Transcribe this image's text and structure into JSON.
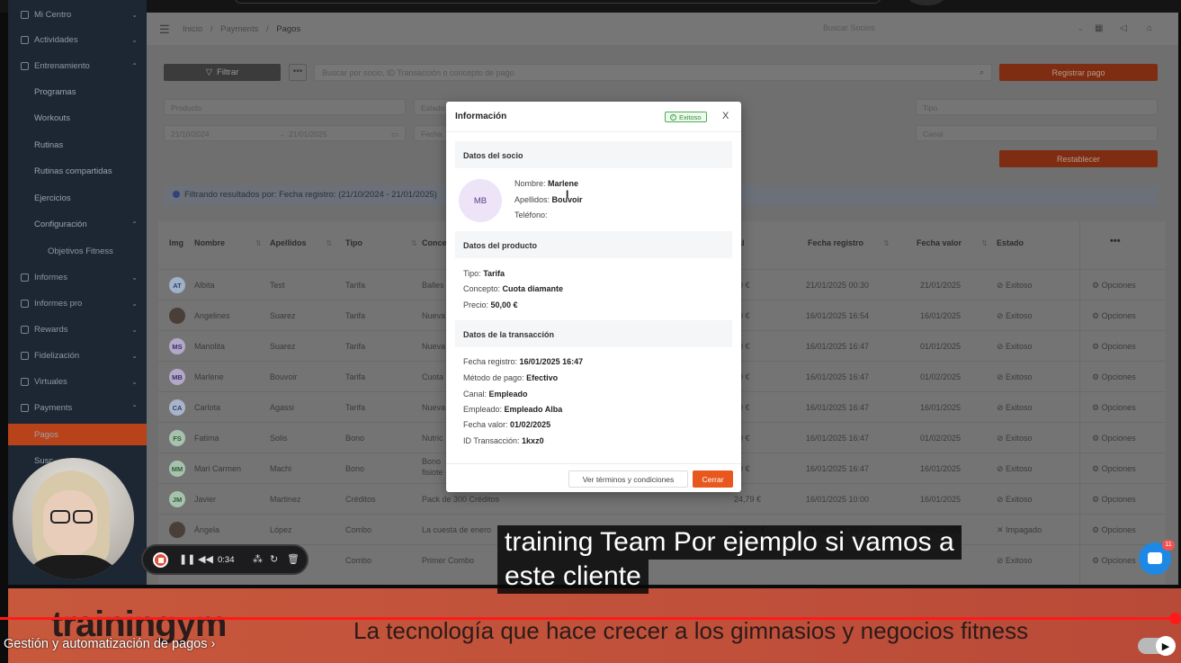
{
  "sidebar": {
    "items": [
      {
        "label": "Mi Centro"
      },
      {
        "label": "Actividades"
      },
      {
        "label": "Entrenamiento"
      },
      {
        "label": "Programas"
      },
      {
        "label": "Workouts"
      },
      {
        "label": "Rutinas"
      },
      {
        "label": "Rutinas compartidas"
      },
      {
        "label": "Ejercicios"
      },
      {
        "label": "Configuración"
      },
      {
        "label": "Objetivos Fitness"
      },
      {
        "label": "Informes"
      },
      {
        "label": "Informes pro"
      },
      {
        "label": "Rewards"
      },
      {
        "label": "Fidelización"
      },
      {
        "label": "Virtuales"
      },
      {
        "label": "Payments"
      },
      {
        "label": "Pagos"
      },
      {
        "label": "Susc"
      }
    ]
  },
  "header": {
    "breadcrumb": [
      "Inicio",
      "/",
      "Payments",
      "/",
      "Pagos"
    ],
    "search_placeholder": "Buscar Socios"
  },
  "toolbar": {
    "filter_label": "Filtrar",
    "more_label": "•••",
    "search_placeholder": "Buscar por socio, ID Transacción o concepto de pago",
    "register_label": "Registrar pago",
    "reset_label": "Restablecer"
  },
  "filters": {
    "producto": "Producto",
    "estado": "Estado",
    "tipo": "Tipo",
    "date_from": "21/10/2024",
    "date_arrow": "→",
    "date_to": "21/01/2025",
    "fecha": "Fecha",
    "canal": "Canal"
  },
  "info_bar": "Filtrando resultados por: Fecha registro: (21/10/2024 - 21/01/2025)",
  "table": {
    "headers": [
      "Img",
      "Nombre",
      "Apellidos",
      "Tipo",
      "Conce",
      "al",
      "Fecha registro",
      "Fecha valor",
      "Estado",
      "•••"
    ],
    "rows": [
      {
        "initials": "AT",
        "nombre": "Albita",
        "apellidos": "Test",
        "tipo": "Tarifa",
        "concepto": "Balles",
        "importe": "00 €",
        "fecha_registro": "21/01/2025 00:30",
        "fecha_valor": "21/01/2025",
        "estado": "Exitoso",
        "opciones": "Opciones"
      },
      {
        "initials": "",
        "nombre": "Angelines",
        "apellidos": "Suarez",
        "tipo": "Tarifa",
        "concepto": "Nueva",
        "importe": "00 €",
        "fecha_registro": "16/01/2025 16:54",
        "fecha_valor": "16/01/2025",
        "estado": "Exitoso",
        "opciones": "Opciones"
      },
      {
        "initials": "MS",
        "nombre": "Manolita",
        "apellidos": "Suarez",
        "tipo": "Tarifa",
        "concepto": "Nueva",
        "importe": "00 €",
        "fecha_registro": "16/01/2025 16:47",
        "fecha_valor": "01/01/2025",
        "estado": "Exitoso",
        "opciones": "Opciones"
      },
      {
        "initials": "MB",
        "nombre": "Marlene",
        "apellidos": "Bouvoir",
        "tipo": "Tarifa",
        "concepto": "Cuota",
        "importe": "00 €",
        "fecha_registro": "16/01/2025 16:47",
        "fecha_valor": "01/02/2025",
        "estado": "Exitoso",
        "opciones": "Opciones"
      },
      {
        "initials": "CA",
        "nombre": "Carlota",
        "apellidos": "Agassi",
        "tipo": "Tarifa",
        "concepto": "Nueva",
        "importe": "00 €",
        "fecha_registro": "16/01/2025 16:47",
        "fecha_valor": "16/01/2025",
        "estado": "Exitoso",
        "opciones": "Opciones"
      },
      {
        "initials": "FS",
        "nombre": "Fatima",
        "apellidos": "Solis",
        "tipo": "Bono",
        "concepto": "Nutric",
        "importe": "00 €",
        "fecha_registro": "16/01/2025 16:47",
        "fecha_valor": "01/02/2025",
        "estado": "Exitoso",
        "opciones": "Opciones"
      },
      {
        "initials": "MM",
        "nombre": "Mari Carmen",
        "apellidos": "Machi",
        "tipo": "Bono",
        "concepto": "Bono fisiote",
        "importe": "00 €",
        "fecha_registro": "16/01/2025 16:47",
        "fecha_valor": "16/01/2025",
        "estado": "Exitoso",
        "opciones": "Opciones"
      },
      {
        "initials": "JM",
        "nombre": "Javier",
        "apellidos": "Martinez",
        "tipo": "Créditos",
        "concepto": "Pack de 300 Créditos",
        "importe": "24,79 €",
        "fecha_registro": "16/01/2025 10:00",
        "fecha_valor": "16/01/2025",
        "estado": "Exitoso",
        "opciones": "Opciones"
      },
      {
        "initials": "",
        "nombre": "Ángela",
        "apellidos": "López",
        "tipo": "Combo",
        "concepto": "La cuesta de enero",
        "importe": "174,20 €",
        "fecha_registro": "14/01/2025 15:27",
        "fecha_valor": "14/01/2025",
        "estado": "Impagado",
        "opciones": "Opciones"
      },
      {
        "initials": "",
        "nombre": "",
        "apellidos": "",
        "tipo": "Combo",
        "concepto": "Primer Combo",
        "importe": "",
        "fecha_registro": "",
        "fecha_valor": "",
        "estado": "Exitoso",
        "opciones": "Opciones"
      }
    ]
  },
  "modal": {
    "title": "Información",
    "badge": "Exitoso",
    "close": "X",
    "sec_socio": "Datos del socio",
    "avatar": "MB",
    "nombre_label": "Nombre:",
    "nombre_value": "Marlene",
    "apellidos_label": "Apellidos:",
    "apellidos_value": "Bouvoir",
    "telefono_label": "Teléfono:",
    "sec_producto": "Datos del producto",
    "tipo_label": "Tipo:",
    "tipo_value": "Tarifa",
    "concepto_label": "Concepto:",
    "concepto_value": "Cuota diamante",
    "precio_label": "Precio:",
    "precio_value": "50,00 €",
    "sec_transaccion": "Datos de la transacción",
    "fecha_registro_label": "Fecha registro:",
    "fecha_registro_value": "16/01/2025 16:47",
    "metodo_label": "Método de pago:",
    "metodo_value": "Efectivo",
    "canal_label": "Canal:",
    "canal_value": "Empleado",
    "empleado_label": "Empleado:",
    "empleado_value": "Empleado Alba",
    "fecha_valor_label": "Fecha valor:",
    "fecha_valor_value": "01/02/2025",
    "id_label": "ID Transacción:",
    "id_value": "1kxz0",
    "terms_button": "Ver términos y condiciones",
    "close_button": "Cerrar"
  },
  "recorder": {
    "time": "0:34"
  },
  "captions": {
    "line1": "training Team Por ejemplo si vamos a",
    "line2": "este cliente"
  },
  "banner": {
    "logo": "trainingym",
    "tagline": "La tecnología que hace crecer a los gimnasios y negocios fitness"
  },
  "video": {
    "chapter": "Gestión y automatización de pagos",
    "chapter_arrow": "›",
    "progress": 0.995
  },
  "chat": {
    "badge": "11"
  },
  "colors": {
    "accent": "#e8581e",
    "success": "#43a047",
    "sidebar_bg": "#1d2733",
    "progress_red": "#ff1a1a"
  }
}
